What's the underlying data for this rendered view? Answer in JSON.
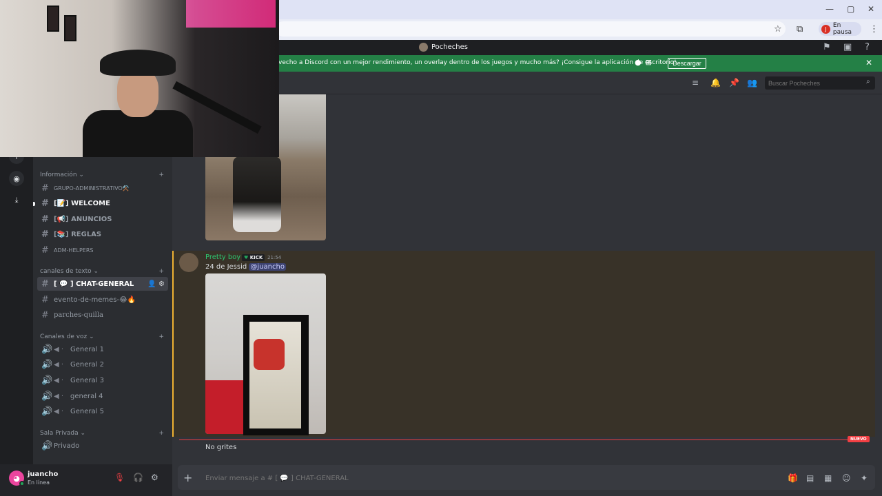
{
  "browser": {
    "window_controls": [
      "—",
      "▢",
      "✕"
    ],
    "profile_initial": "J",
    "profile_status": "En pausa",
    "star_icon": "star-icon",
    "extensions_icon": "puzzle-icon",
    "menu_icon": "kebab-icon"
  },
  "app": {
    "title": "Pocheches"
  },
  "banner": {
    "text": "vecho a Discord con un mejor rendimiento, un overlay dentro de los juegos y mucho más? ¡Consigue la aplicación de escritorio!",
    "button": "Descargar",
    "color": "#248046"
  },
  "sidebar": {
    "categories": {
      "info": "Información",
      "text": "canales de texto",
      "voice": "Canales de voz",
      "private": "Sala Privada"
    },
    "info_channels": [
      {
        "label": "GRUPO-ADMINISTRATIVO⚒️"
      },
      {
        "label": "[📝] WELCOME"
      },
      {
        "label": "[📢] ANUNCIOS"
      },
      {
        "label": "[📚] REGLAS"
      },
      {
        "label": "ADM-HELPERS"
      }
    ],
    "text_channels": [
      {
        "label": "[ 💬 ] CHAT-GENERAL"
      },
      {
        "label": "evento-de-memes-😂🔥"
      },
      {
        "label": "parches-quilla"
      }
    ],
    "voice_channels": [
      {
        "label": "General 1"
      },
      {
        "label": "General 2"
      },
      {
        "label": "General 3"
      },
      {
        "label": "general 4"
      },
      {
        "label": "General 5"
      }
    ],
    "private_channels": [
      {
        "label": "Privado"
      }
    ]
  },
  "user": {
    "name": "juancho",
    "status": "En línea"
  },
  "header": {
    "search_placeholder": "Buscar Pocheches"
  },
  "messages": {
    "m1": {
      "author": "Pretty boy",
      "badge": "KICK",
      "time": "21:54",
      "text": "24 de Jessid",
      "mention": "@juancho"
    },
    "new_badge": "NUEVO",
    "m2": {
      "text": "No grites"
    }
  },
  "composer": {
    "placeholder": "Enviar mensaje a # [ 💬 ] CHAT-GENERAL"
  }
}
